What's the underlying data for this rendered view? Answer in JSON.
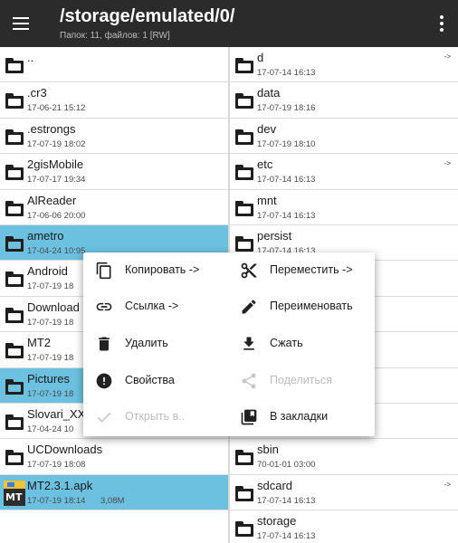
{
  "header": {
    "path": "/storage/emulated/0/",
    "subtitle": "Папок: 11, файлов: 1 [RW]"
  },
  "left_items": [
    {
      "name": "..",
      "date": "",
      "size": "",
      "selected": false,
      "icon": "folder-icon"
    },
    {
      "name": ".cr3",
      "date": "17-06-21 15:12",
      "size": "",
      "selected": false,
      "icon": "folder-icon"
    },
    {
      "name": ".estrongs",
      "date": "17-07-19 18:02",
      "size": "",
      "selected": false,
      "icon": "folder-icon"
    },
    {
      "name": "2gisMobile",
      "date": "17-07-17 19:34",
      "size": "",
      "selected": false,
      "icon": "folder-icon"
    },
    {
      "name": "AlReader",
      "date": "17-06-06 20:00",
      "size": "",
      "selected": false,
      "icon": "folder-icon"
    },
    {
      "name": "ametro",
      "date": "17-04-24 10:95",
      "size": "",
      "selected": true,
      "icon": "folder-icon"
    },
    {
      "name": "Android",
      "date": "17-07-19 18",
      "size": "",
      "selected": false,
      "icon": "folder-icon"
    },
    {
      "name": "Download",
      "date": "17-07-19 18",
      "size": "",
      "selected": false,
      "icon": "folder-icon"
    },
    {
      "name": "MT2",
      "date": "17-07-19 18",
      "size": "",
      "selected": false,
      "icon": "folder-icon"
    },
    {
      "name": "Pictures",
      "date": "17-07-19 18",
      "size": "",
      "selected": true,
      "icon": "folder-icon"
    },
    {
      "name": "Slovari_XX",
      "date": "17-04-24 10",
      "size": "",
      "selected": false,
      "icon": "folder-icon"
    },
    {
      "name": "UCDownloads",
      "date": "17-07-19 18:08",
      "size": "",
      "selected": false,
      "icon": "folder-icon"
    },
    {
      "name": "MT2.3.1.apk",
      "date": "17-07-19 18:14",
      "size": "3,08M",
      "selected": true,
      "icon": "apk-icon"
    }
  ],
  "right_items": [
    {
      "name": "d",
      "date": "17-07-14 16:13",
      "link": "->"
    },
    {
      "name": "data",
      "date": "17-07-19 18:16",
      "link": ""
    },
    {
      "name": "dev",
      "date": "17-07-19 18:10",
      "link": ""
    },
    {
      "name": "etc",
      "date": "17-07-14 16:13",
      "link": "->"
    },
    {
      "name": "mnt",
      "date": "17-07-14 16:13",
      "link": ""
    },
    {
      "name": "persist",
      "date": "17-07-14 16:13",
      "link": ""
    },
    {
      "name": "",
      "date": "",
      "link": ""
    },
    {
      "name": "",
      "date": "",
      "link": ""
    },
    {
      "name": "",
      "date": "",
      "link": ""
    },
    {
      "name": "",
      "date": "",
      "link": ""
    },
    {
      "name": "",
      "date": "",
      "link": ""
    },
    {
      "name": "sbin",
      "date": "70-01-01 03:00",
      "link": ""
    },
    {
      "name": "sdcard",
      "date": "17-07-14 16:13",
      "link": "->"
    },
    {
      "name": "storage",
      "date": "17-07-14 16:13",
      "link": ""
    }
  ],
  "context_menu": {
    "copy": "Копировать ->",
    "move": "Переместить ->",
    "link": "Ссылка ->",
    "rename": "Переименовать",
    "delete": "Удалить",
    "compress": "Сжать",
    "properties": "Свойства",
    "share": "Поделиться",
    "open_in": "Открыть в..",
    "bookmarks": "В закладки"
  },
  "colors": {
    "header_bg": "#2b2b2b",
    "selected_bg": "#6cc1e0",
    "disabled_text": "#bdbdbd"
  }
}
